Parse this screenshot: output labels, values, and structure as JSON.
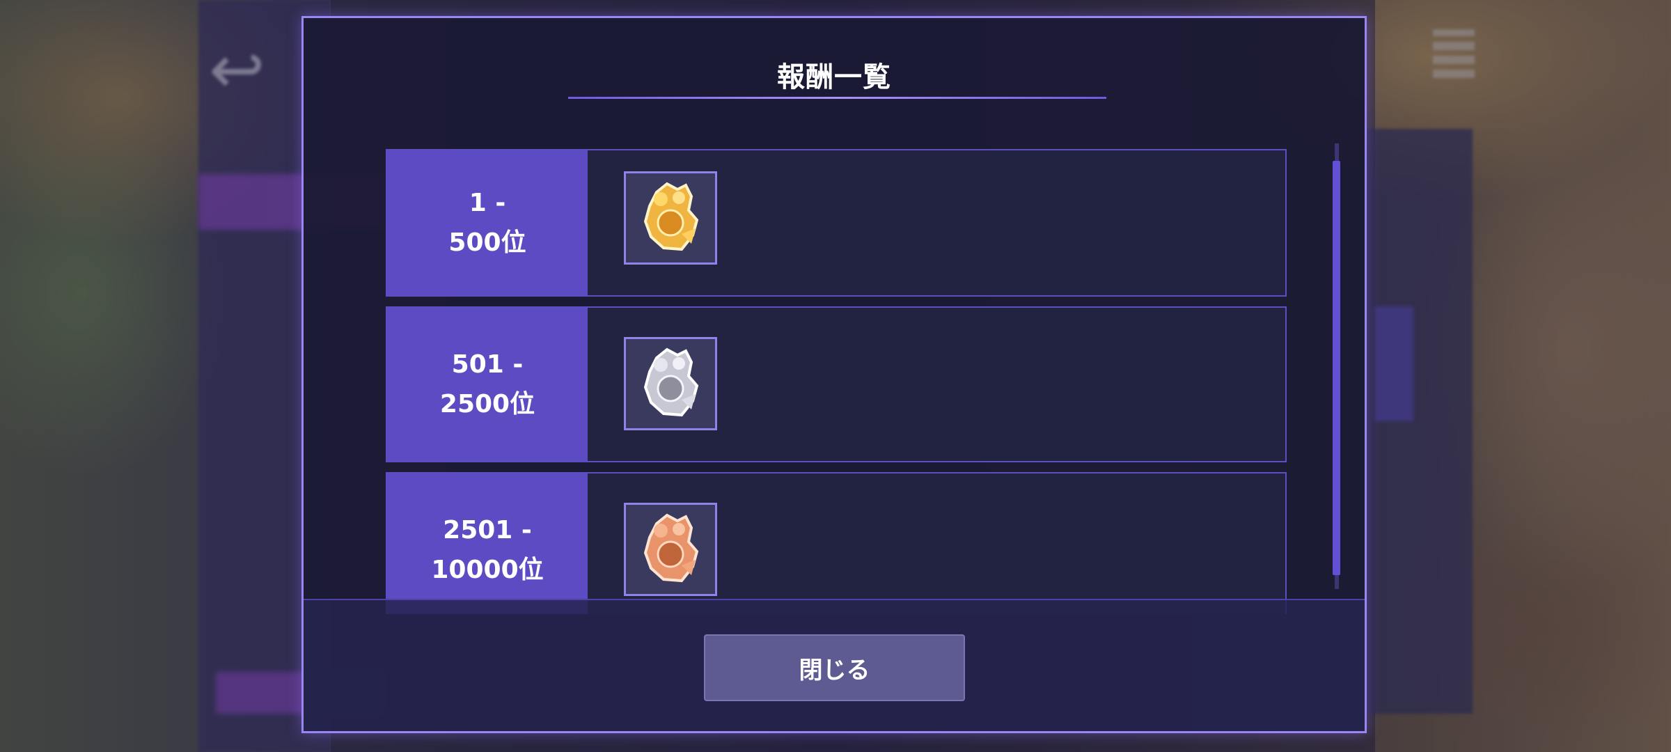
{
  "background": {
    "back_icon": "back-arrow-icon",
    "menu_icon": "menu-icon"
  },
  "dialog": {
    "title": "報酬一覧",
    "rewards": [
      {
        "rank": "1 -\n500位",
        "item_icon": "gold-medal-icon",
        "color": "#f0b540"
      },
      {
        "rank": "501 -\n2500位",
        "item_icon": "silver-medal-icon",
        "color": "#c8c8d4"
      },
      {
        "rank": "2501 -\n10000位",
        "item_icon": "bronze-medal-icon",
        "color": "#e8936a"
      }
    ],
    "close_label": "閉じる"
  },
  "colors": {
    "accent": "#5c4bc2",
    "border": "#9a86f2",
    "panel": "#222241"
  }
}
